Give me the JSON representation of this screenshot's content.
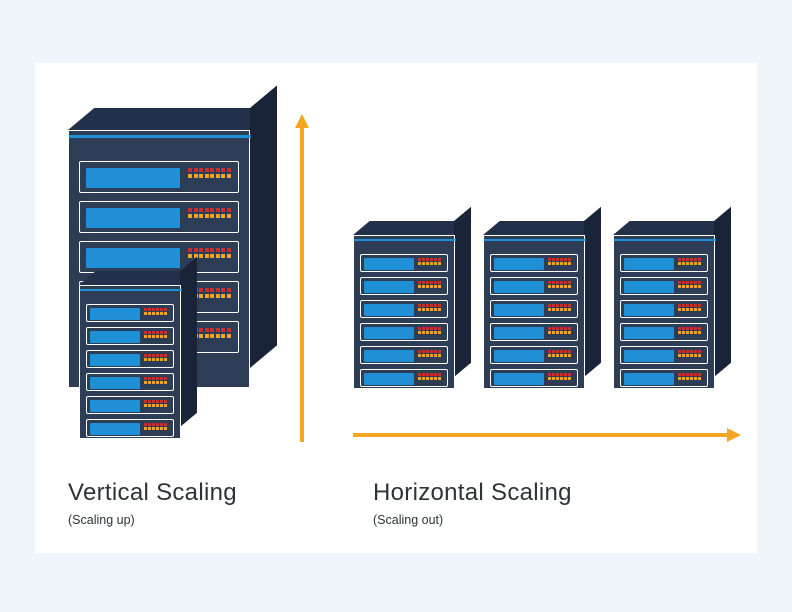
{
  "vertical": {
    "title": "Vertical Scaling",
    "subtitle": "(Scaling up)"
  },
  "horizontal": {
    "title": "Horizontal Scaling",
    "subtitle": "(Scaling out)"
  }
}
